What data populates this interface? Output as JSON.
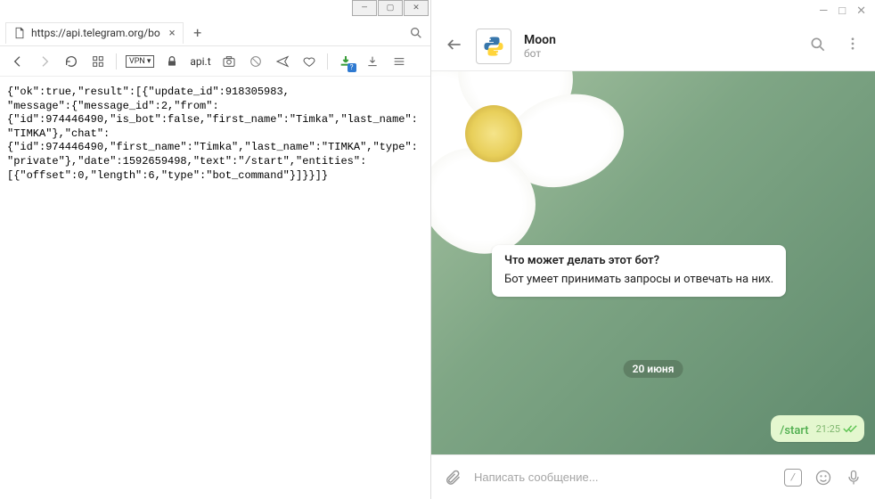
{
  "browser": {
    "tab_title": "https://api.telegram.org/bo",
    "addr_short": "api.t",
    "json_body": "{\"ok\":true,\"result\":[{\"update_id\":918305983,\n\"message\":{\"message_id\":2,\"from\":\n{\"id\":974446490,\"is_bot\":false,\"first_name\":\"Timka\",\"last_name\":\n\"TIMKA\"},\"chat\":\n{\"id\":974446490,\"first_name\":\"Timka\",\"last_name\":\"TIMKA\",\"type\":\n\"private\"},\"date\":1592659498,\"text\":\"/start\",\"entities\":\n[{\"offset\":0,\"length\":6,\"type\":\"bot_command\"}]}}]}",
    "vpn": "VPN"
  },
  "telegram": {
    "bot_name": "Moon",
    "bot_subtitle": "бот",
    "info_question": "Что может делать этот бот?",
    "info_answer": "Бот умеет принимать запросы и отвечать на них.",
    "date_label": "20 июня",
    "msg_text": "/start",
    "msg_time": "21:25",
    "input_placeholder": "Написать сообщение..."
  }
}
